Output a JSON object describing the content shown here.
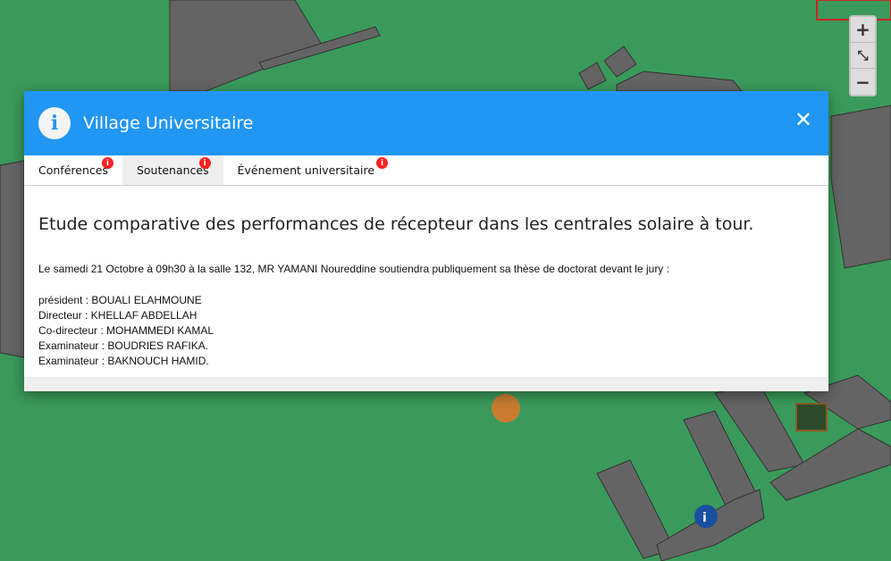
{
  "map": {
    "zoom_in": "+",
    "fit": "⤡",
    "zoom_out": "−"
  },
  "modal": {
    "title": "Village Universitaire",
    "close": "✕",
    "info_icon": "i",
    "tabs": [
      {
        "label": "Conférences",
        "badge": "i"
      },
      {
        "label": "Soutenances",
        "badge": "i"
      },
      {
        "label": "Événement universitaire",
        "badge": "i"
      }
    ],
    "heading": "Etude comparative des performances de récepteur dans les centrales solaire à tour.",
    "intro": "Le samedi 21 Octobre à 09h30 à la salle 132, MR YAMANI Noureddine soutiendra publiquement sa thèse de doctorat devant le jury :",
    "jury": [
      "président : BOUALI ELAHMOUNE",
      "Directeur : KHELLAF ABDELLAH",
      "Co-directeur : MOHAMMEDI KAMAL",
      "Examinateur : BOUDRIES RAFIKA.",
      "Examinateur : BAKNOUCH HAMID."
    ]
  }
}
